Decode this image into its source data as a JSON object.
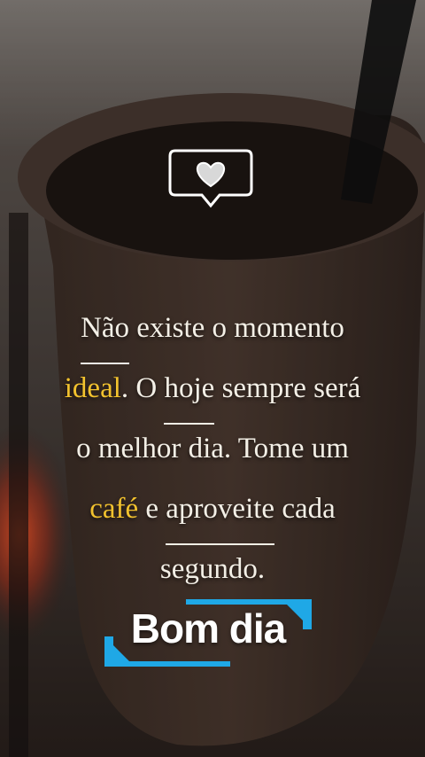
{
  "quote": {
    "line1": {
      "w1": "Não",
      "rest": " existe o momento"
    },
    "line2": {
      "w1": "ideal",
      "mid": ". O ",
      "w2": "hoje",
      "rest": " sempre será"
    },
    "line3": "o melhor dia. Tome um",
    "line4": {
      "w1": "café",
      "mid": " e ",
      "w2": "aproveite",
      "rest": " cada"
    },
    "line5": "segundo."
  },
  "banner": {
    "label": "Bom dia"
  },
  "icons": {
    "badge": "heart-speech-bubble-icon"
  },
  "colors": {
    "highlight": "#f2c22e",
    "accent": "#1fa8e6",
    "text": "#f3efe6"
  }
}
